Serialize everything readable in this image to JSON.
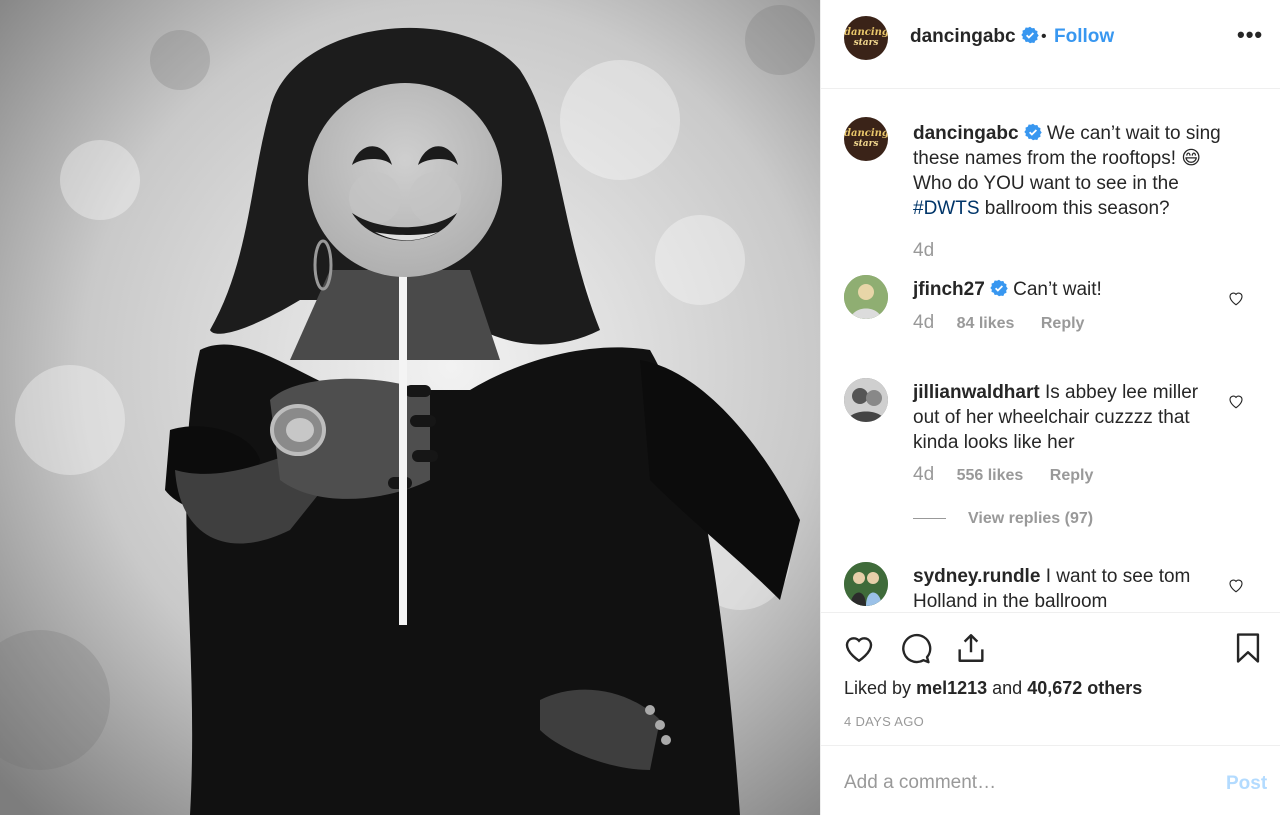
{
  "post_image": {
    "alt": ""
  },
  "header": {
    "username": "dancingabc",
    "avatar_logo_line1": "dancing",
    "avatar_logo_line2": "stars",
    "separator": "•",
    "follow_label": "Follow",
    "more_label": "•••"
  },
  "caption": {
    "username": "dancingabc",
    "text_before": "We can’t wait to sing these names from the rooftops! 😄 Who do YOU want to see in the",
    "hashtag": "#DWTS",
    "text_after": "ballroom this season?",
    "age": "4d"
  },
  "comments": [
    {
      "username": "jfinch27",
      "verified": true,
      "text": "Can’t wait!",
      "age": "4d",
      "likes": "84 likes",
      "reply_label": "Reply"
    },
    {
      "username": "jillianwaldhart",
      "verified": false,
      "text": "Is abbey lee miller out of her wheelchair cuzzzz that kinda looks like her",
      "age": "4d",
      "likes": "556 likes",
      "reply_label": "Reply",
      "view_replies": "View replies (97)"
    },
    {
      "username": "sydney.rundle",
      "verified": false,
      "text": "I want to see tom Holland in the ballroom"
    }
  ],
  "actions": {
    "liked_by_prefix": "Liked by",
    "liked_by_user": "mel1213",
    "liked_by_and": "and",
    "liked_by_others": "40,672 others",
    "time_ago": "4 DAYS AGO"
  },
  "add_comment": {
    "placeholder": "Add a comment…",
    "post_label": "Post"
  },
  "colors": {
    "link_blue": "#3897f0",
    "hashtag": "#003569",
    "muted": "#999999",
    "verified": "#3897f0",
    "post_disabled": "#b3dbff"
  }
}
